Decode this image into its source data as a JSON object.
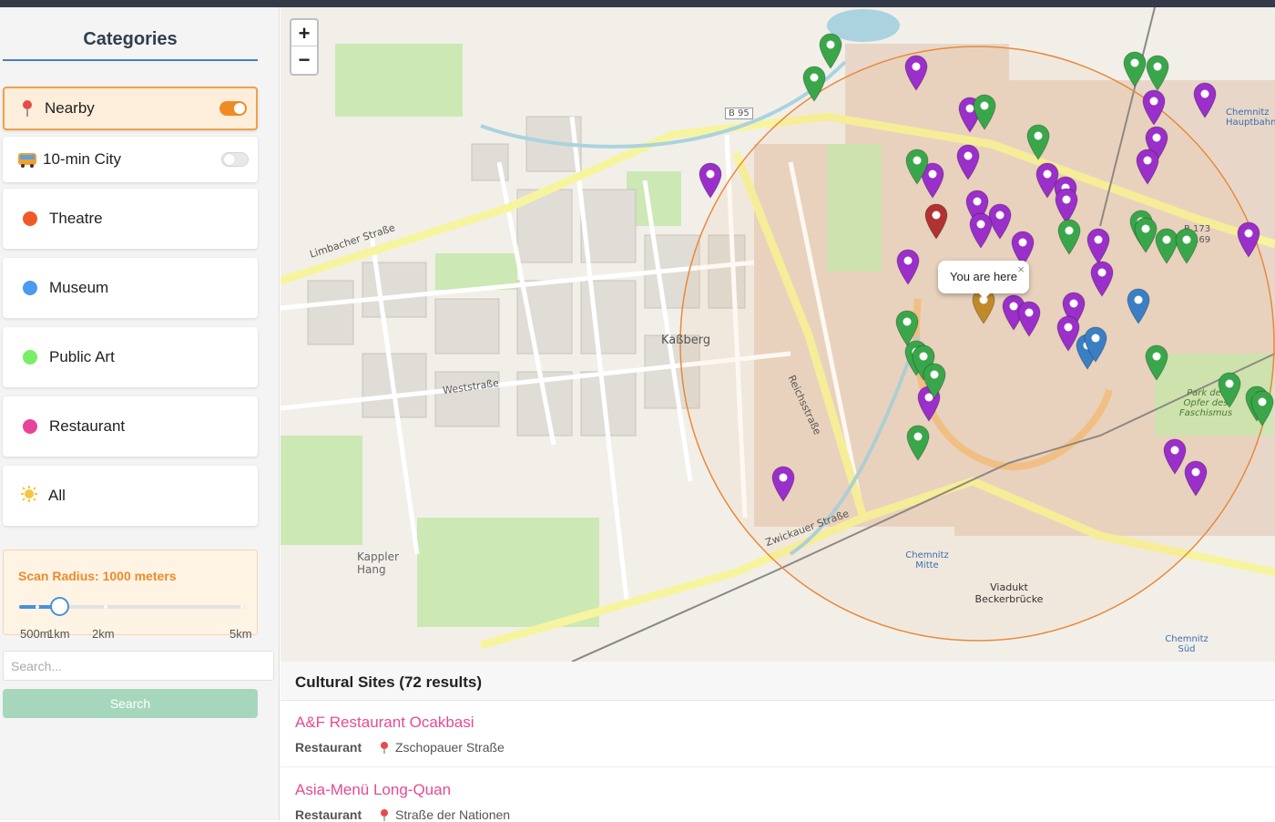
{
  "sidebar": {
    "title": "Categories",
    "items": [
      {
        "label": "Nearby",
        "icon": "pin-icon",
        "toggle": true
      },
      {
        "label": "10-min City",
        "icon": "bus-icon",
        "toggle": false
      },
      {
        "label": "Theatre",
        "color": "#f05a28"
      },
      {
        "label": "Museum",
        "color": "#4a9af0"
      },
      {
        "label": "Public Art",
        "color": "#77ee66"
      },
      {
        "label": "Restaurant",
        "color": "#e8449a"
      },
      {
        "label": "All",
        "icon": "sun-icon"
      }
    ],
    "radius": {
      "label": "Scan Radius: 1000 meters",
      "ticks": [
        "500m",
        "1km",
        "2km",
        "5km"
      ],
      "value_meters": 1000
    },
    "search": {
      "placeholder": "Search...",
      "button": "Search"
    }
  },
  "map": {
    "zoom_in": "+",
    "zoom_out": "−",
    "popup": "You are here",
    "popup_close": "×",
    "labels": {
      "kassberg": "Kaßberg",
      "hbf": "Chemnitz Hauptbahnhof",
      "mitte": "Chemnitz Mitte",
      "sued": "Chemnitz Süd",
      "viadukt": "Viadukt Beckerbrücke",
      "kappler": "Kappler Hang",
      "b95": "B 95",
      "b173": "B 173",
      "b169": "B 169",
      "reichsstr": "Reichsstraße",
      "zwickauer": "Zwickauer Straße",
      "limbacher": "Limbacher Straße",
      "weststr": "Weststraße",
      "park": "Park der Opfer des Faschismus"
    },
    "colors": {
      "theatre": "#b03232",
      "museum": "#3a7fc4",
      "public_art": "#3aa64a",
      "restaurant": "#9a2fc9",
      "user": "#c08a2a"
    }
  },
  "results": {
    "title": "Cultural Sites (72 results)",
    "items": [
      {
        "name": "A&F Restaurant Ocakbasi",
        "category": "Restaurant",
        "address": "Zschopauer Straße"
      },
      {
        "name": "Asia-Menü Long-Quan",
        "category": "Restaurant",
        "address": "Straße der Nationen"
      }
    ]
  }
}
